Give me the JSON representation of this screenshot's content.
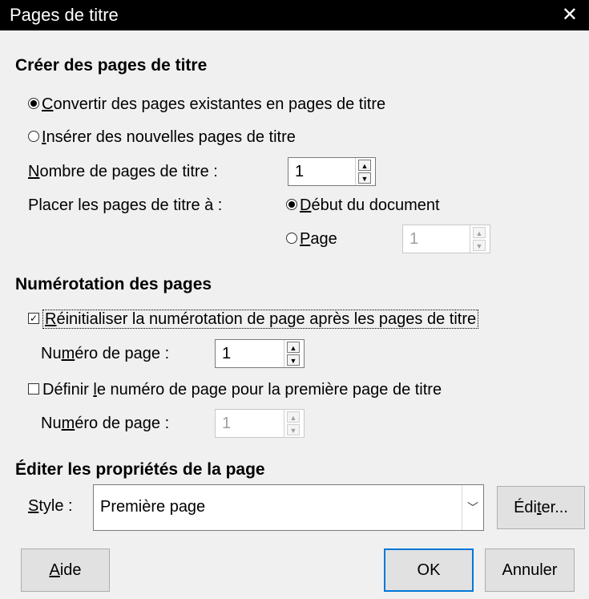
{
  "dialog": {
    "title": "Pages de titre"
  },
  "create": {
    "heading": "Créer des pages de titre",
    "convert": {
      "pre": "",
      "key": "C",
      "post": "onvertir des pages existantes en pages de titre",
      "checked": true
    },
    "insert": {
      "pre": "",
      "key": "I",
      "post": "nsérer des nouvelles pages de titre",
      "checked": false
    },
    "count_label": {
      "pre": "",
      "key": "N",
      "post": "ombre de pages de titre :"
    },
    "count_value": "1",
    "place_label": "Placer les pages de titre à :",
    "start": {
      "pre": "",
      "key": "D",
      "post": "ébut du document",
      "checked": true
    },
    "page": {
      "pre": "",
      "key": "P",
      "post": "age",
      "checked": false
    },
    "page_value": "1"
  },
  "numbering": {
    "heading": "Numérotation des pages",
    "reset": {
      "pre": "",
      "key": "R",
      "post": "éinitialiser la numérotation de page après les pages de titre",
      "checked": true
    },
    "reset_num_label": {
      "pre": "Nu",
      "key": "m",
      "post": "éro de page :"
    },
    "reset_num_value": "1",
    "define": {
      "pre": "Définir ",
      "key": "l",
      "post": "e numéro de page pour la première page de titre",
      "checked": false
    },
    "define_num_label": {
      "pre": "Nu",
      "key": "m",
      "post": "éro de page :"
    },
    "define_num_value": "1"
  },
  "edit": {
    "heading": "Éditer les propriétés de la page",
    "style_label": {
      "pre": "",
      "key": "S",
      "post": "tyle :"
    },
    "style_value": "Première page",
    "edit_button": {
      "pre": "Édi",
      "key": "t",
      "post": "er..."
    }
  },
  "buttons": {
    "help": {
      "pre": "",
      "key": "A",
      "post": "ide"
    },
    "ok": "OK",
    "cancel": "Annuler"
  },
  "icons": {
    "close": "close-icon",
    "spin_up": "chevron-up-icon",
    "spin_down": "chevron-down-icon",
    "dropdown": "chevron-down-icon"
  }
}
